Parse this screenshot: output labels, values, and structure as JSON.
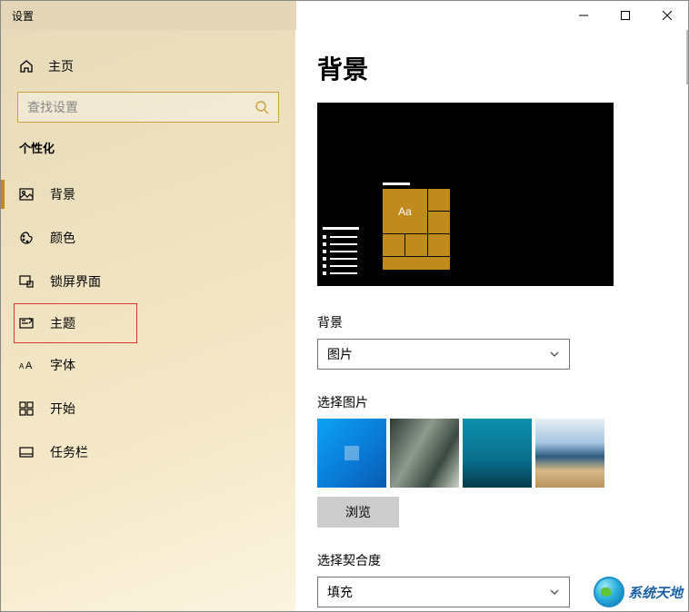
{
  "window": {
    "title": "设置"
  },
  "sidebar": {
    "home": "主页",
    "search_placeholder": "查找设置",
    "category": "个性化",
    "items": [
      {
        "label": "背景"
      },
      {
        "label": "颜色"
      },
      {
        "label": "锁屏界面"
      },
      {
        "label": "主题"
      },
      {
        "label": "字体"
      },
      {
        "label": "开始"
      },
      {
        "label": "任务栏"
      }
    ]
  },
  "page": {
    "title": "背景",
    "preview_sample": "Aa",
    "bg_section_label": "背景",
    "bg_dropdown_value": "图片",
    "choose_image_label": "选择图片",
    "browse_label": "浏览",
    "fit_label": "选择契合度",
    "fit_dropdown_value": "填充"
  },
  "watermark": {
    "text": "系统天地"
  }
}
